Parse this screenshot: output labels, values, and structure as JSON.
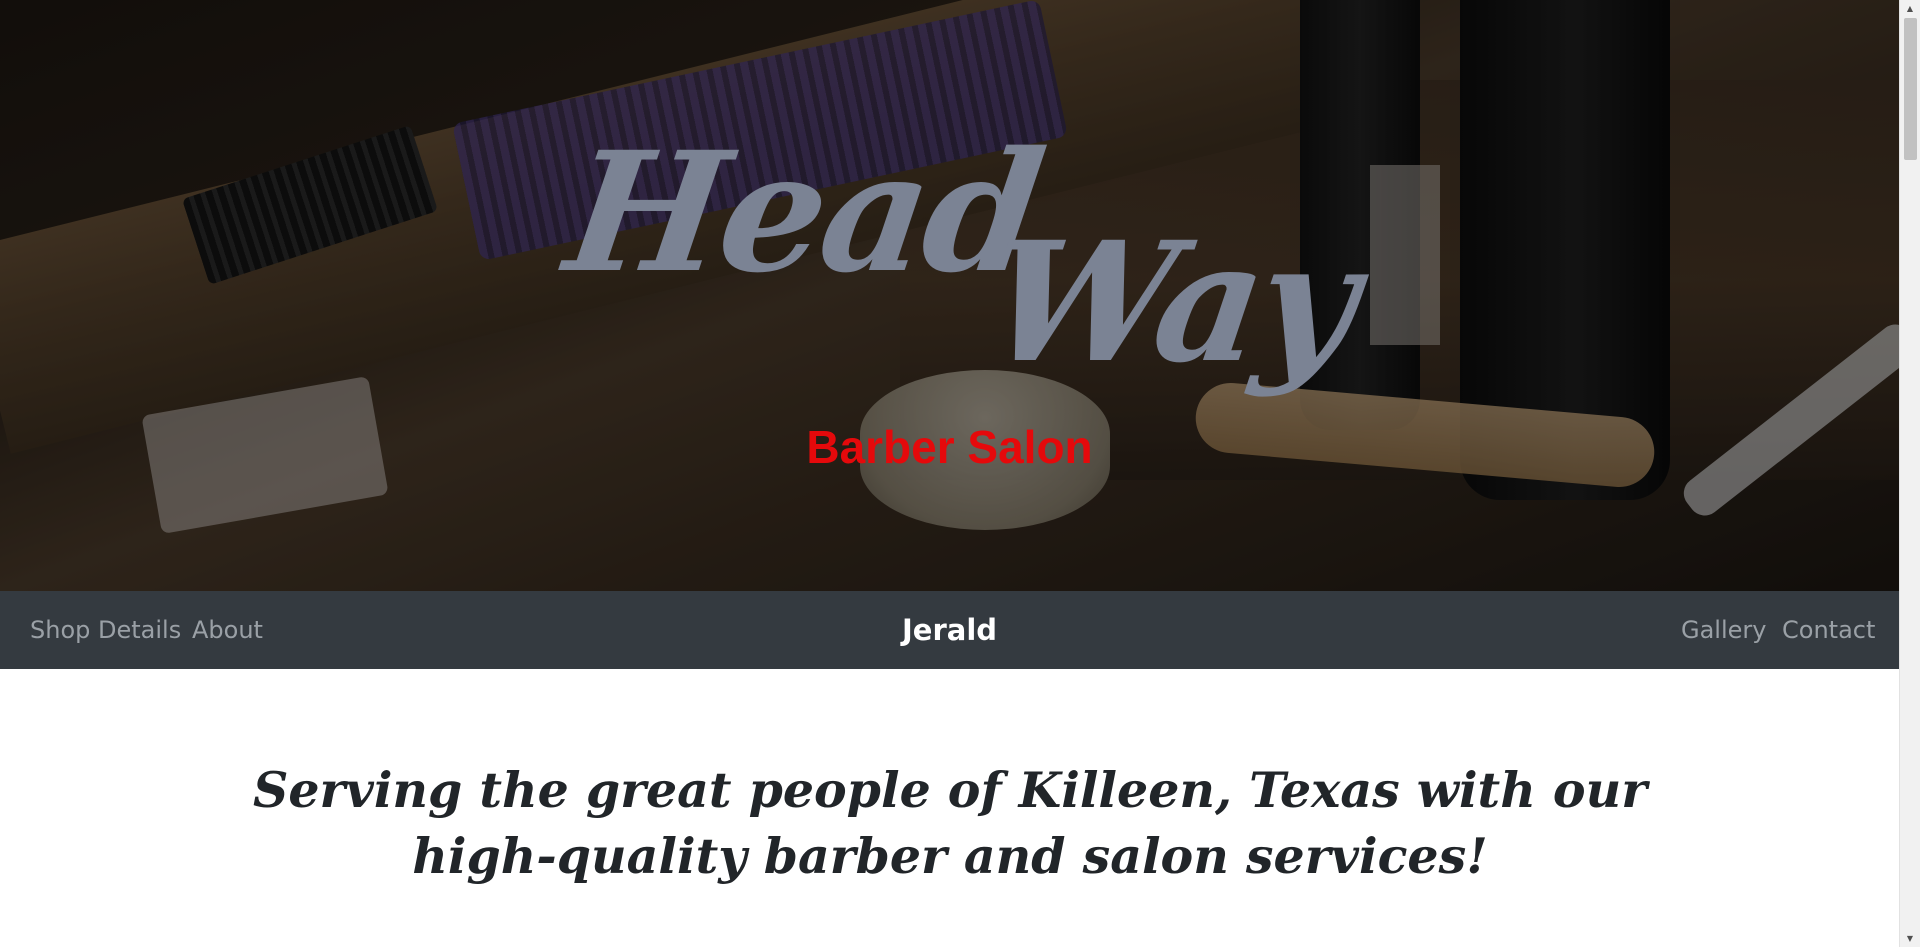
{
  "hero": {
    "brand_word_1": "Head",
    "brand_word_2": "Way",
    "subtitle": "Barber Salon",
    "subtitle_color": "#e5090b",
    "brand_color": "#7b8394"
  },
  "navbar": {
    "left_links": [
      "Shop Details",
      "About"
    ],
    "brand": "Jerald",
    "right_links": [
      "Gallery",
      "Contact"
    ],
    "background": "#343a40"
  },
  "main": {
    "tagline": "Serving the great people of Killeen, Texas with our high-quality barber and salon services!"
  },
  "scrollbar": {
    "up_icon": "triangle-up",
    "down_icon": "triangle-down"
  }
}
